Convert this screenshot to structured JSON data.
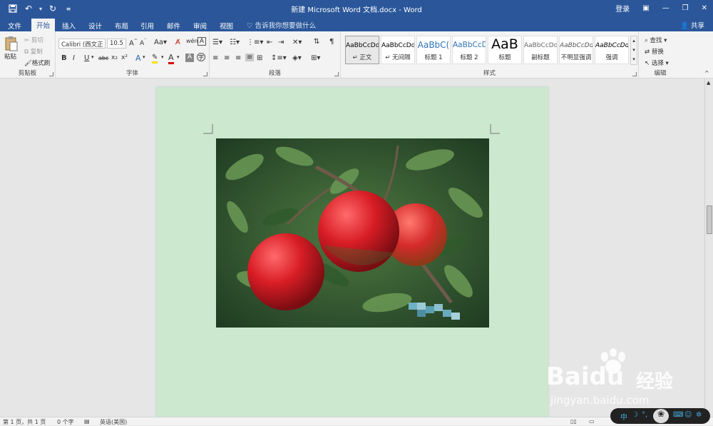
{
  "titlebar": {
    "title": "新建 Microsoft Word 文档.docx - Word",
    "login": "登录"
  },
  "tabs": [
    {
      "label": "文件"
    },
    {
      "label": "开始"
    },
    {
      "label": "插入"
    },
    {
      "label": "设计"
    },
    {
      "label": "布局"
    },
    {
      "label": "引用"
    },
    {
      "label": "邮件"
    },
    {
      "label": "审阅"
    },
    {
      "label": "视图"
    }
  ],
  "tellme": "告诉我你想要做什么",
  "share": "共享",
  "clipboard": {
    "paste": "粘贴",
    "cut": "剪切",
    "copy": "复制",
    "format_painter": "格式刷",
    "label": "剪贴板"
  },
  "font": {
    "name": "Calibri (西文正",
    "size": "10.5",
    "label": "字体"
  },
  "paragraph": {
    "label": "段落"
  },
  "styles": {
    "label": "样式",
    "items": [
      {
        "sample": "AaBbCcDd",
        "name": "↵ 正文"
      },
      {
        "sample": "AaBbCcDd",
        "name": "↵ 无间隔"
      },
      {
        "sample": "AaBbC(",
        "name": "标题 1"
      },
      {
        "sample": "AaBbCcD",
        "name": "标题 2"
      },
      {
        "sample": "AaB",
        "name": "标题"
      },
      {
        "sample": "AaBbCcDd",
        "name": "副标题"
      },
      {
        "sample": "AaBbCcDd",
        "name": "不明显强调"
      },
      {
        "sample": "AaBbCcDd",
        "name": "强调"
      }
    ]
  },
  "editing": {
    "find": "查找",
    "replace": "替换",
    "select": "选择",
    "label": "编辑"
  },
  "status": {
    "page": "第 1 页，共 1 页",
    "words": "0 个字",
    "lang": "英语(美国)"
  },
  "watermark": {
    "brand": "Bai",
    "brand2": "du",
    "cn": "经验",
    "url": "jingyan.baidu.com"
  },
  "colors": {
    "accent": "#2b579a",
    "page": "#cce8cf"
  }
}
